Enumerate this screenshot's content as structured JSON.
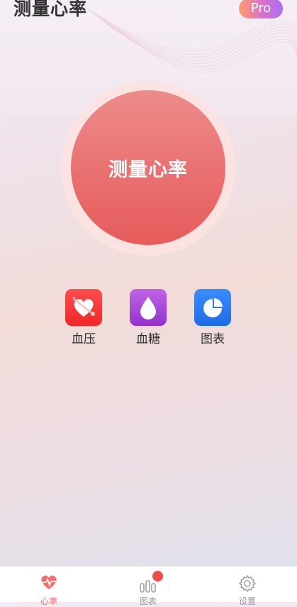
{
  "header": {
    "title": "测量心率",
    "pro_label": "Pro"
  },
  "measure": {
    "button_label": "测量心率"
  },
  "features": [
    {
      "label": "血压",
      "icon": "heart-arrow-icon",
      "color": "#f23535"
    },
    {
      "label": "血糖",
      "icon": "drop-icon",
      "color": "#a947d8"
    },
    {
      "label": "图表",
      "icon": "pie-chart-icon",
      "color": "#2a7bf2"
    }
  ],
  "nav": {
    "items": [
      {
        "label": "心率",
        "icon": "heartbeat-icon",
        "active": true
      },
      {
        "label": "图表",
        "icon": "bar-chart-icon",
        "active": false,
        "has_badge": true
      },
      {
        "label": "设置",
        "icon": "gear-icon",
        "active": false
      }
    ],
    "active_color": "#ff6b6b",
    "inactive_color": "#999999"
  }
}
